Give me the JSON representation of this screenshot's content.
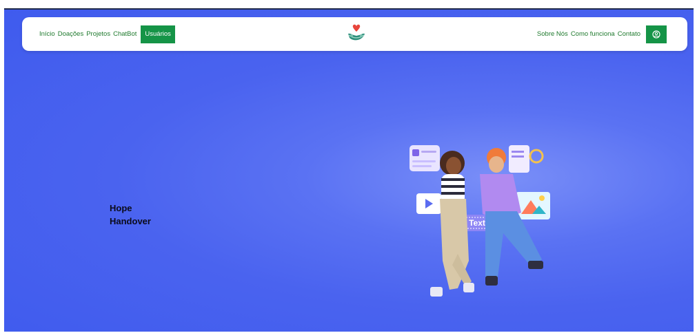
{
  "nav": {
    "left_links": [
      "Início",
      "Doações",
      "Projetos",
      "ChatBot"
    ],
    "active_button": "Usuários",
    "right_links": [
      "Sobre Nós",
      "Como funciona",
      "Contato"
    ],
    "user_icon": "user-circle-icon",
    "logo_icon": "heart-hands-logo"
  },
  "hero": {
    "brand_line1": "Hope",
    "brand_line2": "Handover",
    "illustration_text": "Text"
  },
  "colors": {
    "background": "#4a63ef",
    "accent_green": "#159447",
    "link_green": "#1f7a2e"
  }
}
